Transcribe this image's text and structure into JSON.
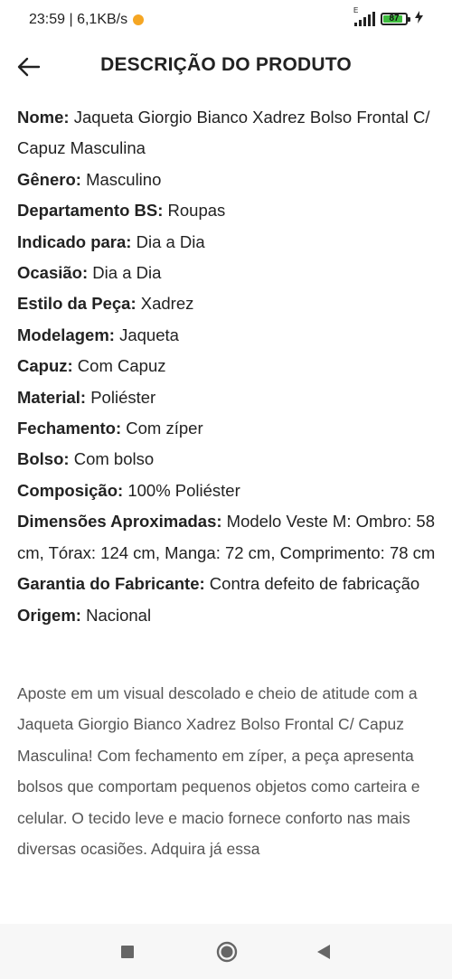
{
  "status_bar": {
    "time_speed": "23:59 | 6,1KB/s",
    "network_type": "E",
    "battery_level": "87",
    "battery_fraction": 0.87,
    "charging_icon": "bolt-icon",
    "colors": {
      "battery_fill": "#3dbb3d"
    }
  },
  "header": {
    "back_icon": "back-arrow-icon",
    "title": "DESCRIÇÃO DO PRODUTO"
  },
  "specs": [
    {
      "key": "Nome:",
      "value": " Jaqueta Giorgio Bianco Xadrez Bolso Frontal C/ Capuz Masculina"
    },
    {
      "key": "Gênero:",
      "value": " Masculino"
    },
    {
      "key": "Departamento BS:",
      "value": " Roupas"
    },
    {
      "key": "Indicado para:",
      "value": " Dia a Dia"
    },
    {
      "key": "Ocasião:",
      "value": " Dia a Dia"
    },
    {
      "key": "Estilo da Peça:",
      "value": " Xadrez"
    },
    {
      "key": "Modelagem:",
      "value": " Jaqueta"
    },
    {
      "key": "Capuz:",
      "value": " Com Capuz"
    },
    {
      "key": "Material:",
      "value": " Poliéster"
    },
    {
      "key": "Fechamento:",
      "value": " Com zíper"
    },
    {
      "key": "Bolso:",
      "value": " Com bolso"
    },
    {
      "key": "Composição:",
      "value": " 100% Poliéster"
    },
    {
      "key": "Dimensões Aproximadas:",
      "value": " Modelo Veste M: Ombro: 58 cm, Tórax: 124 cm, Manga: 72 cm, Comprimento: 78 cm"
    },
    {
      "key": "Garantia do Fabricante:",
      "value": " Contra defeito de fabricação"
    },
    {
      "key": "Origem:",
      "value": " Nacional"
    }
  ],
  "description": "Aposte em um visual descolado e cheio de atitude com a Jaqueta Giorgio Bianco Xadrez Bolso Frontal C/ Capuz Masculina! Com fechamento em zíper, a peça apresenta bolsos que comportam pequenos objetos como carteira e celular. O tecido leve e macio fornece conforto nas mais diversas ocasiões. Adquira já essa",
  "nav_bar": {
    "recent_icon": "recent-apps-icon",
    "home_icon": "home-icon",
    "back_icon": "nav-back-icon"
  }
}
